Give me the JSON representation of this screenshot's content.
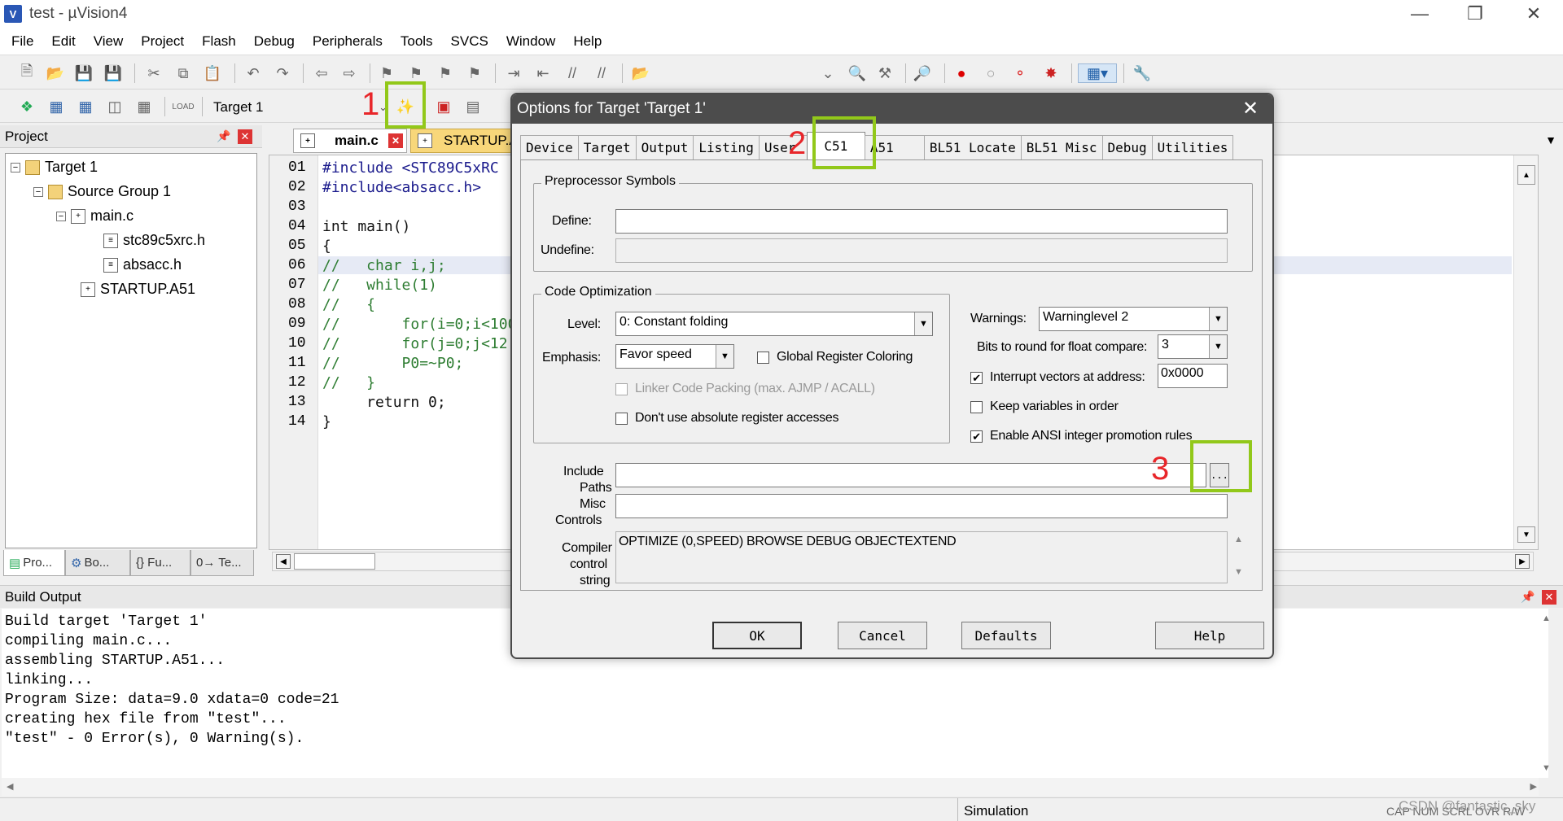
{
  "window": {
    "title": "test  - µVision4",
    "icon_letter": "V",
    "minimize_icon": "minimize-icon",
    "maximize_icon": "restore-icon",
    "close_icon": "close-icon"
  },
  "menu": [
    "File",
    "Edit",
    "View",
    "Project",
    "Flash",
    "Debug",
    "Peripherals",
    "Tools",
    "SVCS",
    "Window",
    "Help"
  ],
  "toolbar2": {
    "target_select": "Target 1"
  },
  "project_panel": {
    "title": "Project",
    "tree": {
      "target": "Target 1",
      "group": "Source Group 1",
      "file1": "main.c",
      "header1": "stc89c5xrc.h",
      "header2": "absacc.h",
      "file2": "STARTUP.A51"
    },
    "tabs": [
      "Pro...",
      "Bo...",
      "{} Fu...",
      "0→ Te..."
    ]
  },
  "editor": {
    "tabs": [
      "main.c",
      "STARTUP.A"
    ],
    "line_numbers": [
      "01",
      "02",
      "03",
      "04",
      "05",
      "06",
      "07",
      "08",
      "09",
      "10",
      "11",
      "12",
      "13",
      "14"
    ],
    "lines": [
      "#include <STC89C5xRC",
      "#include<absacc.h>",
      "",
      "int main()",
      "{",
      "//   char i,j;",
      "//   while(1)",
      "//   {",
      "//       for(i=0;i<100",
      "//       for(j=0;j<12",
      "//       P0=~P0;",
      "//   }",
      "     return 0;",
      "}"
    ]
  },
  "build_output": {
    "title": "Build Output",
    "lines": [
      "Build target 'Target 1'",
      "compiling main.c...",
      "assembling STARTUP.A51...",
      "linking...",
      "Program Size: data=9.0 xdata=0 code=21",
      "creating hex file from \"test\"...",
      "\"test\" - 0 Error(s), 0 Warning(s)."
    ]
  },
  "statusbar": {
    "mode": "Simulation",
    "indicators": "CAP  NUM  SCRL  OVR  R/W",
    "watermark": "CSDN @fantastic_sky"
  },
  "dialog": {
    "title": "Options for Target 'Target 1'",
    "tabs": [
      "Device",
      "Target",
      "Output",
      "Listing",
      "User",
      "C51",
      "A51",
      "BL51 Locate",
      "BL51 Misc",
      "Debug",
      "Utilities"
    ],
    "active_tab": "C51",
    "preprocessor": {
      "group_label": "Preprocessor Symbols",
      "define_label": "Define:",
      "define_value": "",
      "undefine_label": "Undefine:",
      "undefine_value": ""
    },
    "code_opt": {
      "group_label": "Code Optimization",
      "level_label": "Level:",
      "level_value": "0: Constant folding",
      "emphasis_label": "Emphasis:",
      "emphasis_value": "Favor speed",
      "global_reg_coloring": "Global Register Coloring",
      "linker_code_packing": "Linker Code Packing (max. AJMP / ACALL)",
      "no_abs_reg": "Don't use absolute register accesses"
    },
    "right": {
      "warnings_label": "Warnings:",
      "warnings_value": "Warninglevel 2",
      "bits_label": "Bits to round for float compare:",
      "bits_value": "3",
      "interrupt_label": "Interrupt vectors at address:",
      "interrupt_value": "0x0000",
      "keep_vars": "Keep variables in order",
      "ansi": "Enable ANSI integer promotion rules",
      "interrupt_checked": true,
      "keep_vars_checked": false,
      "ansi_checked": true
    },
    "include_paths_label_1": "Include",
    "include_paths_label_2": "Paths",
    "include_paths_value": "",
    "browse_label": "...",
    "misc_label_1": "Misc",
    "misc_label_2": "Controls",
    "misc_value": "",
    "compiler_label_1": "Compiler",
    "compiler_label_2": "control",
    "compiler_label_3": "string",
    "compiler_value": "OPTIMIZE (0,SPEED) BROWSE DEBUG OBJECTEXTEND",
    "buttons": {
      "ok": "OK",
      "cancel": "Cancel",
      "defaults": "Defaults",
      "help": "Help"
    }
  },
  "annotations": {
    "n1": "1",
    "n2": "2",
    "n3": "3",
    "highlight_color": "#92c81a",
    "number_color": "#e8262a"
  }
}
